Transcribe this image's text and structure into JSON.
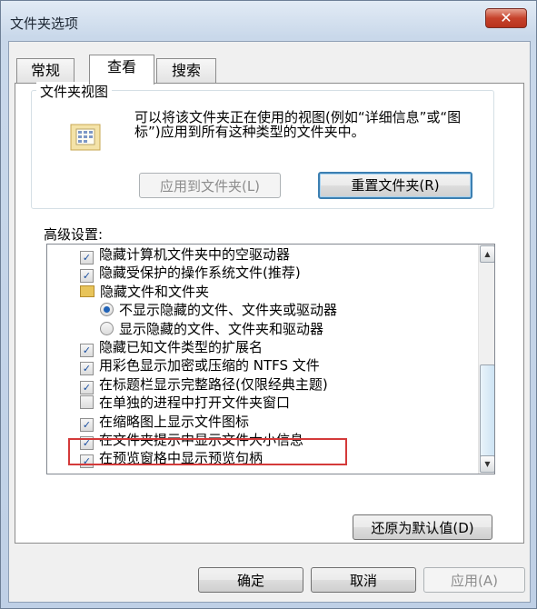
{
  "window": {
    "title": "文件夹选项",
    "close_glyph": "✕"
  },
  "tabs": [
    {
      "label": "常规"
    },
    {
      "label": "查看"
    },
    {
      "label": "搜索"
    }
  ],
  "folder_views": {
    "title": "文件夹视图",
    "description": "可以将该文件夹正在使用的视图(例如“详细信息”或“图标”)应用到所有这种类型的文件夹中。",
    "apply_button": "应用到文件夹(L)",
    "reset_button": "重置文件夹(R)"
  },
  "advanced": {
    "label": "高级设置:",
    "items": [
      {
        "type": "check",
        "checked": true,
        "label": "隐藏计算机文件夹中的空驱动器"
      },
      {
        "type": "check",
        "checked": true,
        "label": "隐藏受保护的操作系统文件(推荐)"
      },
      {
        "type": "folder",
        "label": "隐藏文件和文件夹"
      },
      {
        "type": "radio",
        "checked": true,
        "label": "不显示隐藏的文件、文件夹或驱动器"
      },
      {
        "type": "radio",
        "checked": false,
        "label": "显示隐藏的文件、文件夹和驱动器"
      },
      {
        "type": "check",
        "checked": true,
        "label": "隐藏已知文件类型的扩展名"
      },
      {
        "type": "check",
        "checked": true,
        "label": "用彩色显示加密或压缩的 NTFS 文件"
      },
      {
        "type": "check",
        "checked": true,
        "label": "在标题栏显示完整路径(仅限经典主题)"
      },
      {
        "type": "check",
        "checked": false,
        "label": "在单独的进程中打开文件夹窗口"
      },
      {
        "type": "check",
        "checked": true,
        "label": "在缩略图上显示文件图标"
      },
      {
        "type": "check",
        "checked": true,
        "label": "在文件夹提示中显示文件大小信息"
      },
      {
        "type": "check",
        "checked": true,
        "label": "在预览窗格中显示预览句柄"
      }
    ],
    "restore_button": "还原为默认值(D)"
  },
  "footer": {
    "ok": "确定",
    "cancel": "取消",
    "apply": "应用(A)"
  },
  "colors": {
    "annotation": "#d43a3a",
    "close": "#c6422b"
  }
}
